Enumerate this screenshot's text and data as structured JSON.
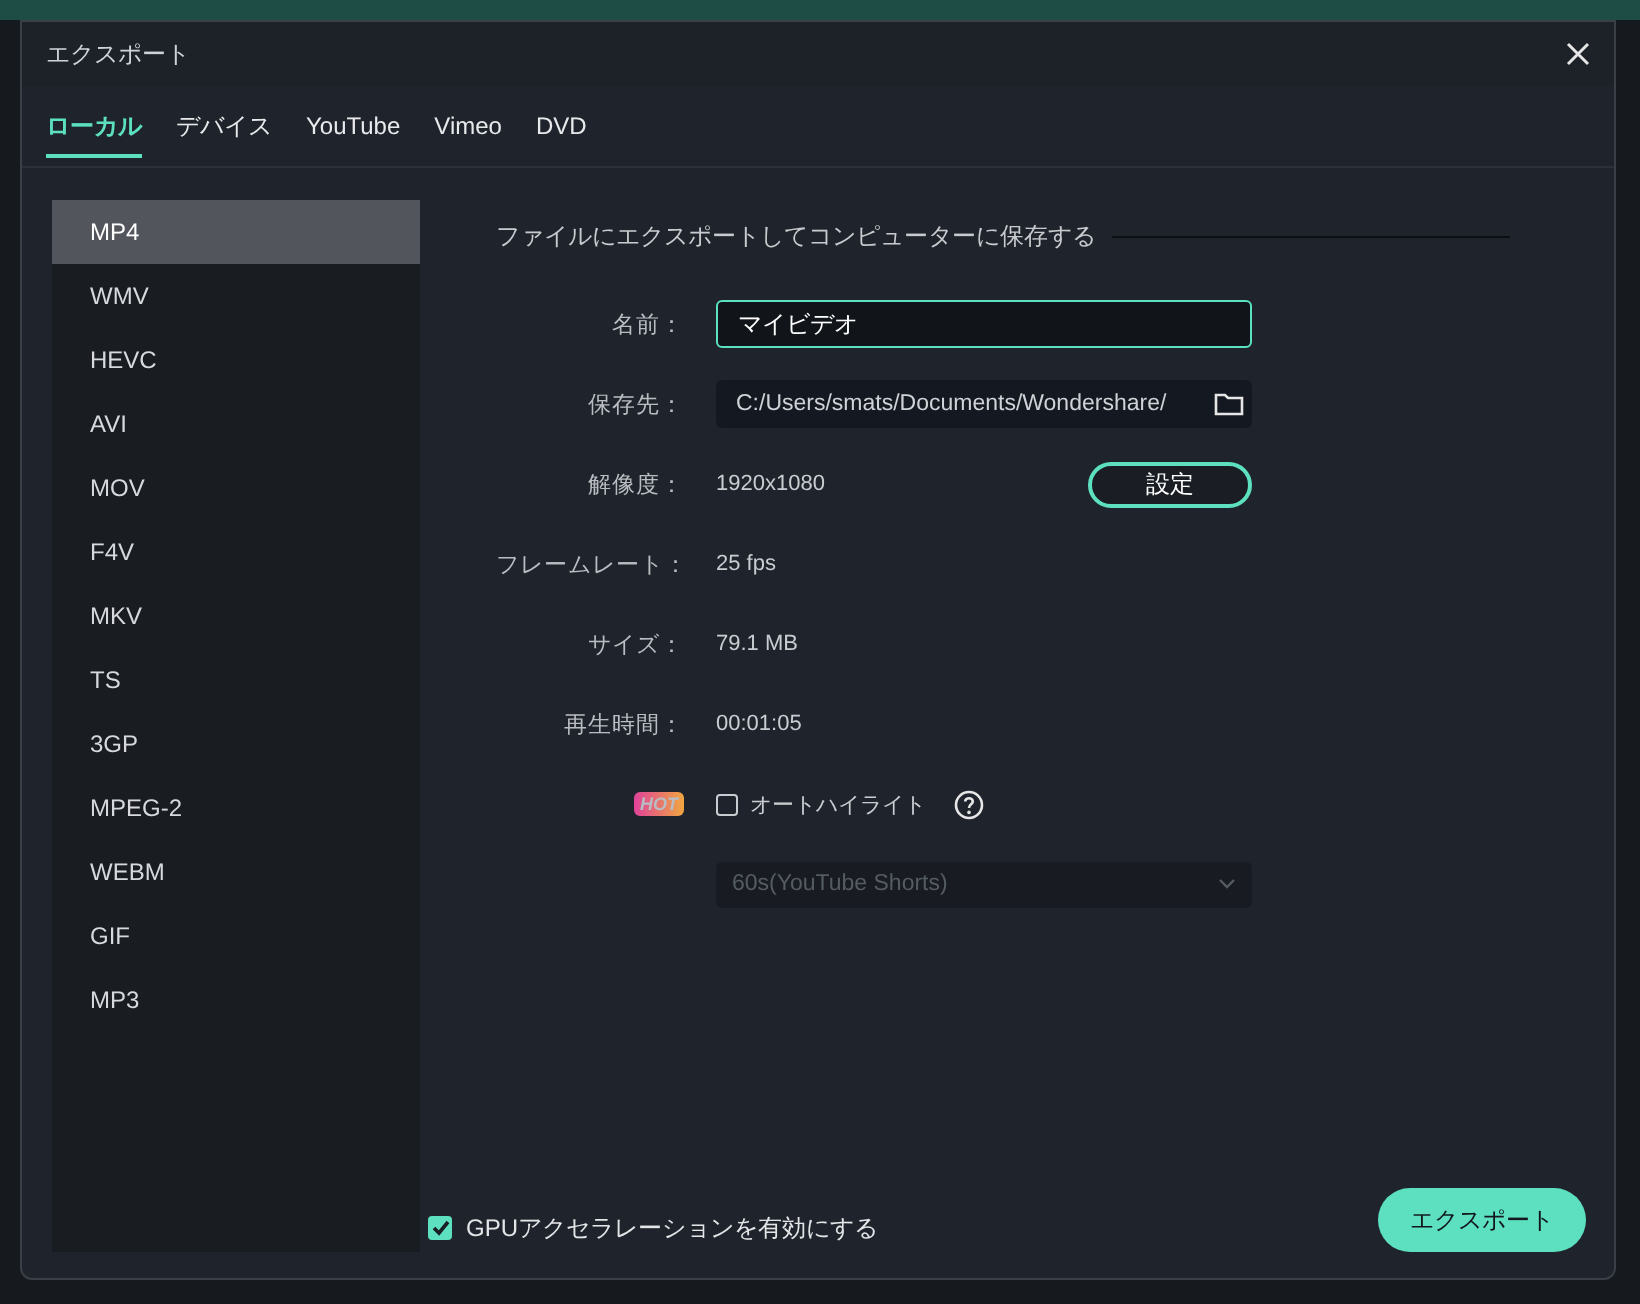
{
  "window": {
    "title": "エクスポート"
  },
  "tabs": [
    {
      "label": "ローカル",
      "selected": true
    },
    {
      "label": "デバイス",
      "selected": false
    },
    {
      "label": "YouTube",
      "selected": false
    },
    {
      "label": "Vimeo",
      "selected": false
    },
    {
      "label": "DVD",
      "selected": false
    }
  ],
  "formats": [
    {
      "label": "MP4",
      "selected": true
    },
    {
      "label": "WMV",
      "selected": false
    },
    {
      "label": "HEVC",
      "selected": false
    },
    {
      "label": "AVI",
      "selected": false
    },
    {
      "label": "MOV",
      "selected": false
    },
    {
      "label": "F4V",
      "selected": false
    },
    {
      "label": "MKV",
      "selected": false
    },
    {
      "label": "TS",
      "selected": false
    },
    {
      "label": "3GP",
      "selected": false
    },
    {
      "label": "MPEG-2",
      "selected": false
    },
    {
      "label": "WEBM",
      "selected": false
    },
    {
      "label": "GIF",
      "selected": false
    },
    {
      "label": "MP3",
      "selected": false
    }
  ],
  "section_title": "ファイルにエクスポートしてコンピューターに保存する",
  "fields": [
    {
      "kind": "input",
      "label": "名前：",
      "value": "マイビデオ"
    },
    {
      "kind": "path",
      "label": "保存先：",
      "value": "C:/Users/smats/Documents/Wondershare/"
    },
    {
      "kind": "button",
      "label": "解像度：",
      "value": "1920x1080",
      "button": "設定"
    },
    {
      "kind": "text",
      "label": "フレームレート：",
      "value": "25 fps"
    },
    {
      "kind": "text",
      "label": "サイズ：",
      "value": "79.1 MB"
    },
    {
      "kind": "text",
      "label": "再生時間：",
      "value": "00:01:05"
    }
  ],
  "auto_highlight": {
    "badge": "HOT",
    "label": "オートハイライト",
    "checked": false
  },
  "duration_select": {
    "value": "60s(YouTube Shorts)",
    "disabled": true
  },
  "gpu": {
    "label": "GPUアクセラレーションを有効にする",
    "checked": true
  },
  "export_button": "エクスポート"
}
